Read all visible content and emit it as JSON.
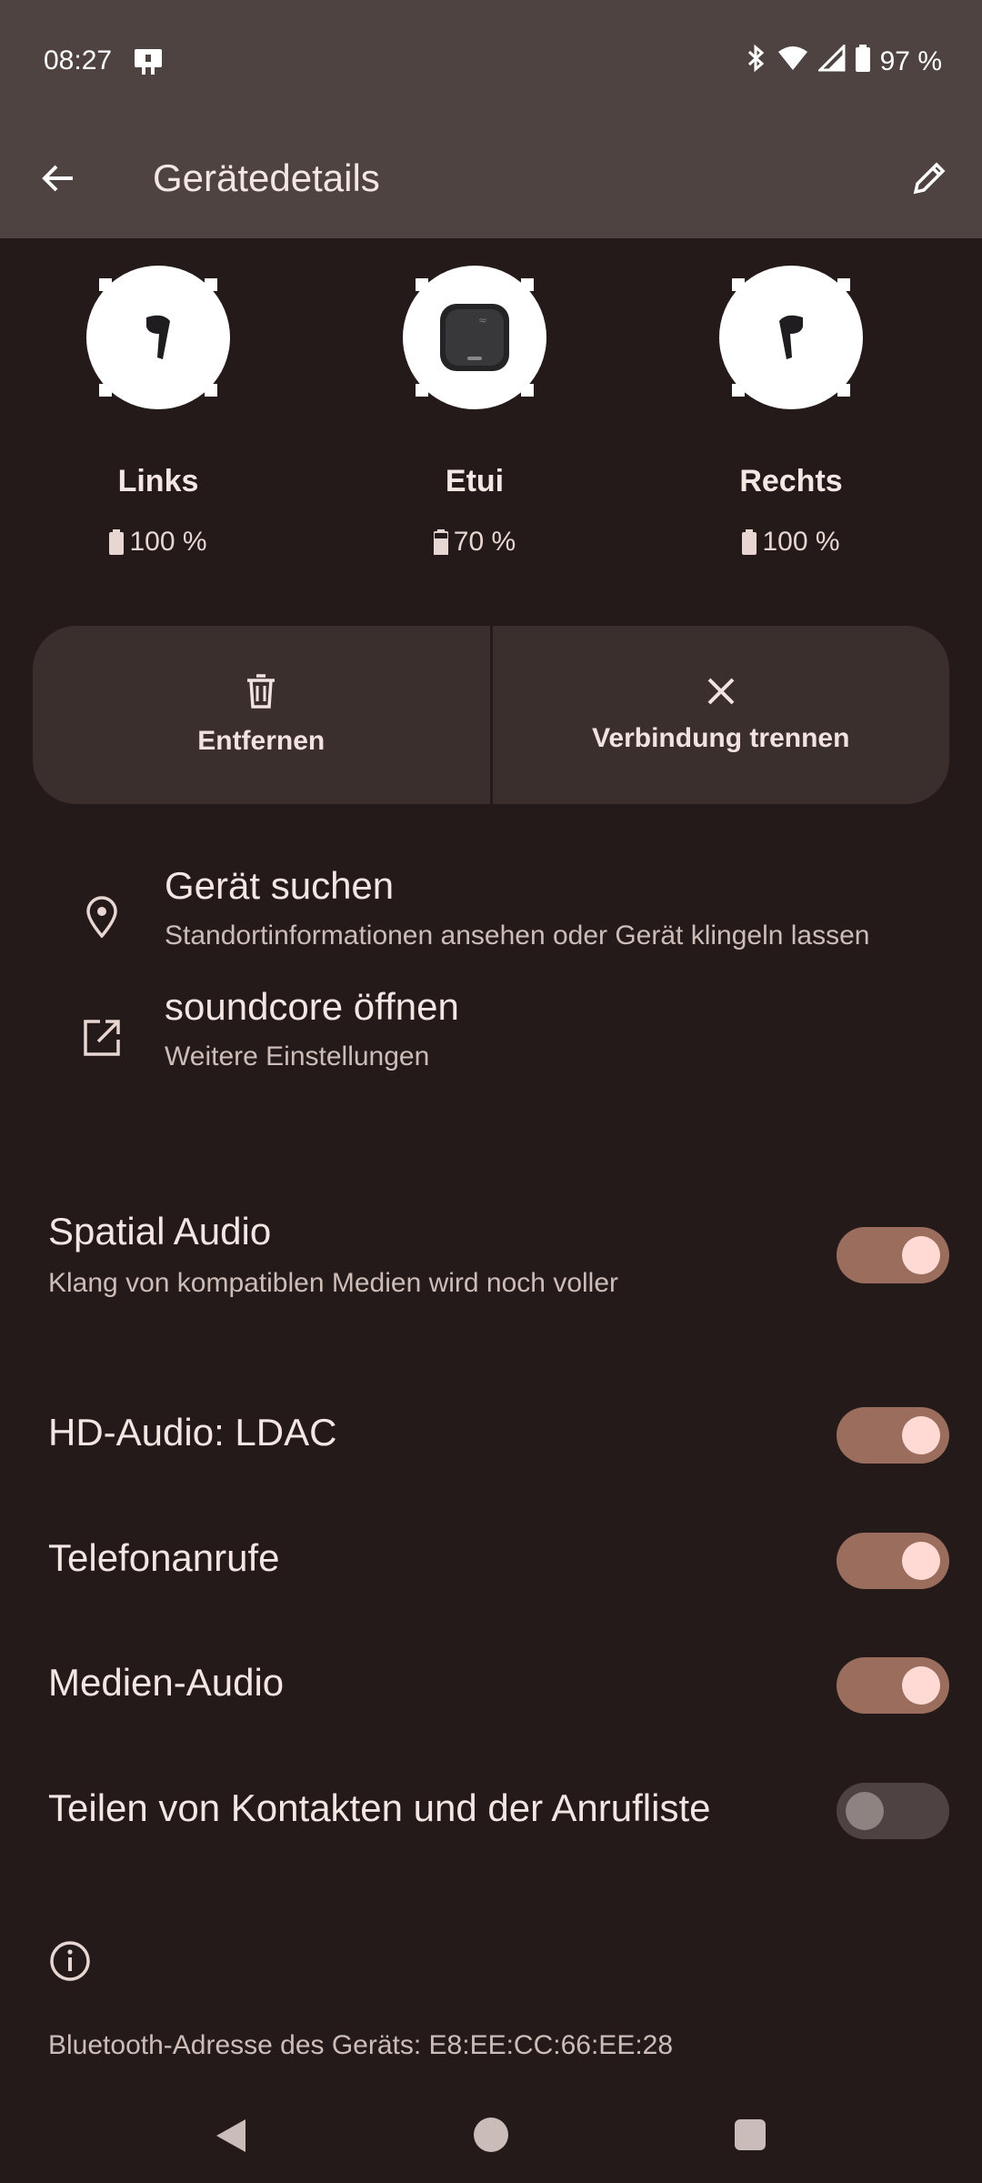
{
  "status_bar": {
    "time": "08:27",
    "battery": "97 %"
  },
  "app_bar": {
    "title": "Gerätedetails"
  },
  "devices": [
    {
      "name": "Links",
      "battery": "100 %",
      "icon": "left-earbud-icon"
    },
    {
      "name": "Etui",
      "battery": "70 %",
      "icon": "charging-case-icon"
    },
    {
      "name": "Rechts",
      "battery": "100 %",
      "icon": "right-earbud-icon"
    }
  ],
  "actions": {
    "remove_label": "Entfernen",
    "disconnect_label": "Verbindung trennen"
  },
  "links": [
    {
      "title": "Gerät suchen",
      "subtitle": "Standortinformationen ansehen oder Gerät klingeln lassen",
      "icon": "location-pin-icon"
    },
    {
      "title": "soundcore öffnen",
      "subtitle": "Weitere Einstellungen",
      "icon": "open-external-icon"
    }
  ],
  "settings": [
    {
      "title": "Spatial Audio",
      "subtitle": "Klang von kompatiblen Medien wird noch voller",
      "on": true
    },
    {
      "title": "HD-Audio: LDAC",
      "on": true
    },
    {
      "title": "Telefonanrufe",
      "on": true
    },
    {
      "title": "Medien-Audio",
      "on": true
    },
    {
      "title": "Teilen von Kontakten und der Anrufliste",
      "on": false
    }
  ],
  "footer": {
    "address": "Bluetooth-Adresse des Geräts: E8:EE:CC:66:EE:28"
  },
  "colors": {
    "background": "#241a19",
    "app_bar": "#4f4342",
    "toggle_on": "#9a6d5d",
    "toggle_off": "#4e4342"
  }
}
